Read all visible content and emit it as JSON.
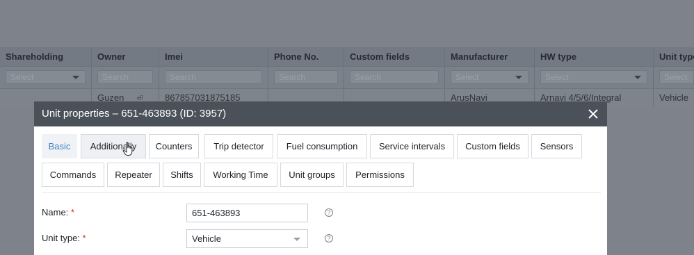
{
  "grid": {
    "columns": [
      {
        "title": "Shareholding",
        "filter": "Select",
        "filter_type": "select",
        "value": ""
      },
      {
        "title": "Owner",
        "filter": "Search",
        "filter_type": "text",
        "value": "Guzen"
      },
      {
        "title": "Imei",
        "filter": "Search",
        "filter_type": "text",
        "value": "867857031875185"
      },
      {
        "title": "Phone No.",
        "filter": "Search",
        "filter_type": "text",
        "value": ""
      },
      {
        "title": "Custom fields",
        "filter": "Search",
        "filter_type": "text",
        "value": ""
      },
      {
        "title": "Manufacturer",
        "filter": "Select",
        "filter_type": "select",
        "value": "ArusNavi"
      },
      {
        "title": "HW type",
        "filter": "Select",
        "filter_type": "select",
        "value": "Arnavi 4/5/6/Integral"
      },
      {
        "title": "Unit type",
        "filter": "Select",
        "filter_type": "select",
        "value": "Vehicle"
      }
    ]
  },
  "modal": {
    "title": "Unit properties – 651-463893 (ID: 3957)",
    "close_icon": "close-icon",
    "tabs_row1": [
      "Basic",
      "Additionally",
      "Counters",
      "Trip detector",
      "Fuel consumption",
      "Service intervals",
      "Custom fields",
      "Sensors"
    ],
    "tabs_row2": [
      "Commands",
      "Repeater",
      "Shifts",
      "Working Time",
      "Unit groups",
      "Permissions"
    ],
    "active_tab": "Basic",
    "form": {
      "name_label": "Name:",
      "name_value": "651-463893",
      "unit_type_label": "Unit type:",
      "unit_type_value": "Vehicle",
      "required_mark": "*",
      "help_glyph": "?"
    }
  },
  "colors": {
    "accent": "#3b82c4",
    "title_bar": "#4a5159",
    "required": "#e02424"
  }
}
